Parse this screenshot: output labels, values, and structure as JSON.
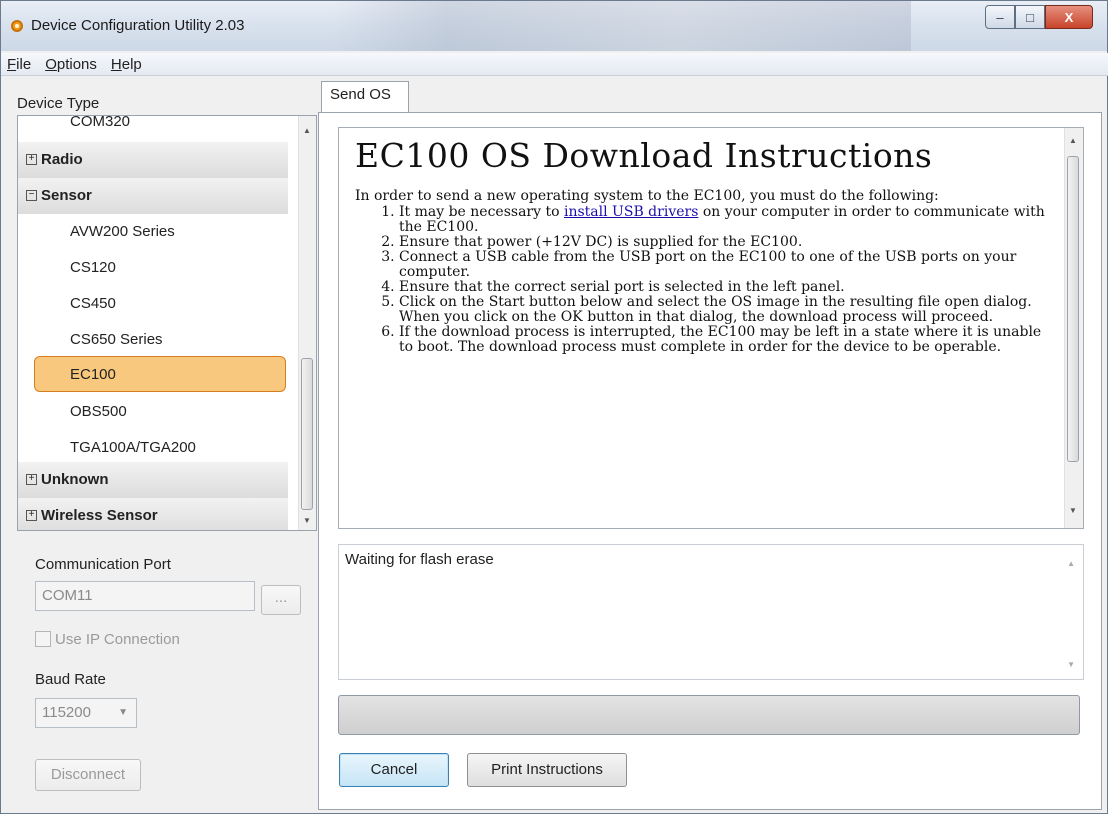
{
  "window": {
    "title": "Device Configuration Utility 2.03",
    "controls": {
      "minimize": "–",
      "maximize": "□",
      "close": "X"
    }
  },
  "menu": [
    {
      "label": "File",
      "mnemonic": "F",
      "rest": "ile"
    },
    {
      "label": "Options",
      "mnemonic": "O",
      "rest": "ptions"
    },
    {
      "label": "Help",
      "mnemonic": "H",
      "rest": "elp"
    }
  ],
  "sidebar": {
    "device_type_label": "Device Type",
    "tree": [
      {
        "type": "leaf",
        "label": "COM320"
      },
      {
        "type": "group",
        "label": "Radio",
        "expander": "+"
      },
      {
        "type": "group",
        "label": "Sensor",
        "expander": "−"
      },
      {
        "type": "leaf",
        "label": "AVW200 Series"
      },
      {
        "type": "leaf",
        "label": "CS120"
      },
      {
        "type": "leaf",
        "label": "CS450"
      },
      {
        "type": "leaf",
        "label": "CS650 Series"
      },
      {
        "type": "leaf",
        "label": "EC100",
        "selected": true
      },
      {
        "type": "leaf",
        "label": "OBS500"
      },
      {
        "type": "leaf",
        "label": "TGA100A/TGA200"
      },
      {
        "type": "group",
        "label": "Unknown",
        "expander": "+"
      },
      {
        "type": "group",
        "label": "Wireless Sensor",
        "expander": "+"
      }
    ],
    "comm_port_label": "Communication Port",
    "comm_port_value": "COM11",
    "browse_label": "...",
    "use_ip_label": "Use IP Connection",
    "baud_rate_label": "Baud Rate",
    "baud_rate_value": "115200",
    "disconnect_label": "Disconnect"
  },
  "tabs": [
    {
      "label": "Send OS",
      "active": true
    }
  ],
  "instructions": {
    "heading": "EC100 OS Download Instructions",
    "intro": "In order to send a new operating system to the EC100, you must do the following:",
    "step1_before": "It may be necessary to ",
    "step1_link": "install USB drivers",
    "step1_after": " on your computer in order to communicate with the EC100.",
    "step2": "Ensure that power (+12V DC) is supplied for the EC100.",
    "step3": "Connect a USB cable from the USB port on the EC100 to one of the USB ports on your computer.",
    "step4": "Ensure that the correct serial port is selected in the left panel.",
    "step5": "Click on the Start button below and select the OS image in the resulting file open dialog. When you click on the OK button in that dialog, the download process will proceed.",
    "step6": "If the download process is interrupted, the EC100 may be left in a state where it is unable to boot. The download process must complete in order for the device to be operable."
  },
  "log": {
    "text": "Waiting for flash erase"
  },
  "progress": {
    "fraction": 0.0
  },
  "buttons": {
    "cancel": "Cancel",
    "print": "Print Instructions"
  }
}
